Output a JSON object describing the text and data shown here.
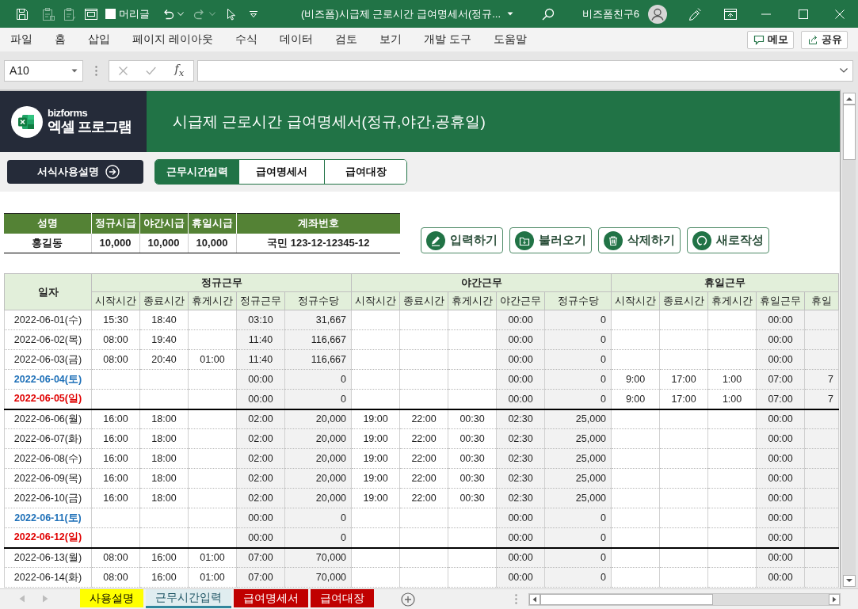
{
  "window": {
    "title": "(비즈폼)시급제 근로시간 급여명세서(정규...",
    "user": "비즈폼친구6"
  },
  "quick_access": [
    {
      "disabled": false
    },
    {
      "disabled": true
    },
    {
      "disabled": true
    },
    {
      "disabled": false
    }
  ],
  "headings_toggle": {
    "label": "머리글",
    "checked": false
  },
  "undo_redo": [
    {
      "disabled": false
    },
    {
      "disabled": true
    }
  ],
  "menu": [
    "파일",
    "홈",
    "삽입",
    "페이지 레이아웃",
    "수식",
    "데이터",
    "검토",
    "보기",
    "개발 도구",
    "도움말"
  ],
  "menu_buttons": [
    "메모",
    "공유"
  ],
  "formula_bar": {
    "name_box": "A10",
    "function_label": "f$_{x}$"
  },
  "sheet": {
    "logo": {
      "brand": "bizforms",
      "product": "엑셀 프로그램"
    },
    "title": "시급제 근로시간 급여명세서(정규,야간,공휴일)",
    "guide_button": "서식사용설명",
    "nav_tabs": [
      {
        "label": "근무시간입력",
        "selected": true
      },
      {
        "label": "급여명세서",
        "selected": false
      },
      {
        "label": "급여대장",
        "selected": false
      }
    ],
    "employee": {
      "columns": [
        "성명",
        "정규시급",
        "야간시급",
        "휴일시급",
        "계좌번호"
      ],
      "values": [
        "홍길동",
        "10,000",
        "10,000",
        "10,000",
        "국민 123-12-12345-12"
      ]
    },
    "actions": [
      "입력하기",
      "불러오기",
      "삭제하기",
      "새로작성"
    ],
    "table": {
      "date_header": "일자",
      "groups": [
        {
          "title": "정규근무",
          "columns": [
            {
              "label": "시작시간",
              "kind": "input"
            },
            {
              "label": "종료시간",
              "kind": "input"
            },
            {
              "label": "휴게시간",
              "kind": "input"
            },
            {
              "label": "정규근무",
              "kind": "total"
            },
            {
              "label": "정규수당",
              "kind": "amount"
            }
          ]
        },
        {
          "title": "야간근무",
          "columns": [
            {
              "label": "시작시간",
              "kind": "input"
            },
            {
              "label": "종료시간",
              "kind": "input"
            },
            {
              "label": "휴게시간",
              "kind": "input"
            },
            {
              "label": "야간근무",
              "kind": "total"
            },
            {
              "label": "정규수당",
              "kind": "amount"
            }
          ]
        },
        {
          "title": "휴일근무",
          "columns": [
            {
              "label": "시작시간",
              "kind": "input"
            },
            {
              "label": "종료시간",
              "kind": "input"
            },
            {
              "label": "휴게시간",
              "kind": "input"
            },
            {
              "label": "휴일근무",
              "kind": "total"
            },
            {
              "label": "휴일",
              "kind": "amount"
            }
          ]
        }
      ],
      "rows": [
        {
          "date": "2022-06-01(수)",
          "kind": "weekday",
          "cells": [
            "15:30",
            "18:40",
            null,
            "03:10",
            "31,667",
            null,
            null,
            null,
            "00:00",
            "0",
            null,
            null,
            null,
            "00:00",
            null
          ]
        },
        {
          "date": "2022-06-02(목)",
          "kind": "weekday",
          "cells": [
            "08:00",
            "19:40",
            null,
            "11:40",
            "116,667",
            null,
            null,
            null,
            "00:00",
            "0",
            null,
            null,
            null,
            "00:00",
            null
          ]
        },
        {
          "date": "2022-06-03(금)",
          "kind": "weekday",
          "cells": [
            "08:00",
            "20:40",
            "01:00",
            "11:40",
            "116,667",
            null,
            null,
            null,
            "00:00",
            "0",
            null,
            null,
            null,
            "00:00",
            null
          ]
        },
        {
          "date": "2022-06-04(토)",
          "kind": "saturday",
          "cells": [
            null,
            null,
            null,
            "00:00",
            "0",
            null,
            null,
            null,
            "00:00",
            "0",
            "9:00",
            "17:00",
            "1:00",
            "07:00",
            "7"
          ]
        },
        {
          "date": "2022-06-05(일)",
          "kind": "sunday",
          "cells": [
            null,
            null,
            null,
            "00:00",
            "0",
            null,
            null,
            null,
            "00:00",
            "0",
            "9:00",
            "17:00",
            "1:00",
            "07:00",
            "7"
          ]
        },
        {
          "date": "2022-06-06(월)",
          "kind": "weekday",
          "cells": [
            "16:00",
            "18:00",
            null,
            "02:00",
            "20,000",
            "19:00",
            "22:00",
            "00:30",
            "02:30",
            "25,000",
            null,
            null,
            null,
            "00:00",
            null
          ]
        },
        {
          "date": "2022-06-07(화)",
          "kind": "weekday",
          "cells": [
            "16:00",
            "18:00",
            null,
            "02:00",
            "20,000",
            "19:00",
            "22:00",
            "00:30",
            "02:30",
            "25,000",
            null,
            null,
            null,
            "00:00",
            null
          ]
        },
        {
          "date": "2022-06-08(수)",
          "kind": "weekday",
          "cells": [
            "16:00",
            "18:00",
            null,
            "02:00",
            "20,000",
            "19:00",
            "22:00",
            "00:30",
            "02:30",
            "25,000",
            null,
            null,
            null,
            "00:00",
            null
          ]
        },
        {
          "date": "2022-06-09(목)",
          "kind": "weekday",
          "cells": [
            "16:00",
            "18:00",
            null,
            "02:00",
            "20,000",
            "19:00",
            "22:00",
            "00:30",
            "02:30",
            "25,000",
            null,
            null,
            null,
            "00:00",
            null
          ]
        },
        {
          "date": "2022-06-10(금)",
          "kind": "weekday",
          "cells": [
            "16:00",
            "18:00",
            null,
            "02:00",
            "20,000",
            "19:00",
            "22:00",
            "00:30",
            "02:30",
            "25,000",
            null,
            null,
            null,
            "00:00",
            null
          ]
        },
        {
          "date": "2022-06-11(토)",
          "kind": "saturday",
          "cells": [
            null,
            null,
            null,
            "00:00",
            "0",
            null,
            null,
            null,
            "00:00",
            "0",
            null,
            null,
            null,
            "00:00",
            null
          ]
        },
        {
          "date": "2022-06-12(일)",
          "kind": "sunday",
          "cells": [
            null,
            null,
            null,
            "00:00",
            "0",
            null,
            null,
            null,
            "00:00",
            "0",
            null,
            null,
            null,
            "00:00",
            null
          ]
        },
        {
          "date": "2022-06-13(월)",
          "kind": "weekday",
          "cells": [
            "08:00",
            "16:00",
            "01:00",
            "07:00",
            "70,000",
            null,
            null,
            null,
            "00:00",
            "0",
            null,
            null,
            null,
            "00:00",
            null
          ]
        },
        {
          "date": "2022-06-14(화)",
          "kind": "weekday",
          "cells": [
            "08:00",
            "16:00",
            "01:00",
            "07:00",
            "70,000",
            null,
            null,
            null,
            "00:00",
            "0",
            null,
            null,
            null,
            "00:00",
            null
          ]
        }
      ]
    }
  },
  "sheet_tabs": [
    {
      "label": "사용설명",
      "color": "#ffff00",
      "selected": false
    },
    {
      "label": "근무시간입력",
      "color": "#31859c",
      "selected": true
    },
    {
      "label": "급여명세서",
      "color": "#c00000",
      "selected": false
    },
    {
      "label": "급여대장",
      "color": "#c00000",
      "selected": false
    }
  ]
}
